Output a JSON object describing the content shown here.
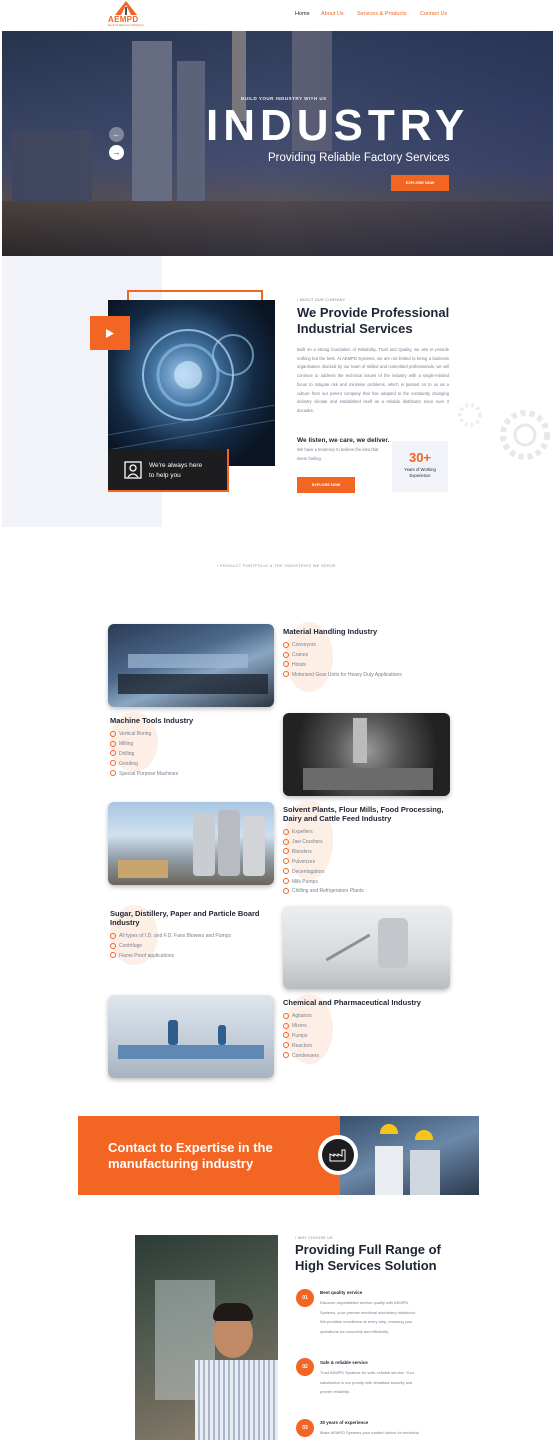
{
  "brand": {
    "logo_text": "AEMPD",
    "logo_sub": "Electrical Machinery Distributors",
    "accent": "#f26522"
  },
  "nav": {
    "items": [
      "Home",
      "About Us",
      "Services & Products",
      "Contact Us"
    ],
    "active": "Home"
  },
  "hero": {
    "eyebrow": "BUILD YOUR INDUSTRY WITH US",
    "title": "INDUSTRY",
    "subtitle": "Providing Reliable Factory Services",
    "button": "EXPLORE NOW",
    "prev_icon": "arrow-left-icon",
    "next_icon": "arrow-right-icon"
  },
  "about": {
    "eyebrow": "/ ABOUT OUR COMPANY",
    "title_line1": "We Provide Professional",
    "title_line2": "Industrial Services",
    "paragraph": "Built on a strong foundation of Reliability, Trust and Quality, we aim to provide nothing but the best. At AEMPD Systems, we are not limited to being a business organisation. Backed by our team of skilled and committed professionals, we will continue to address the technical issues of the industry with a single-minded focus to mitigate risk and minimise problems, which is passed on to us as a culture from our parent company that has adapted to the constantly changing industry climate and established itself as a reliable distributor since over 3 decades.",
    "subheading": "We listen, we care, we deliver.",
    "sub_paragraph": "We have a tendency to believe the idea that seem fooling.",
    "button": "EXPLORE NOW",
    "help_text_line1": "We're always here",
    "help_text_line2": "to help you",
    "stat_value": "30+",
    "stat_label_line1": "Years of Working",
    "stat_label_line2": "Experience"
  },
  "portfolio": {
    "eyebrow": "/ PRODUCT PORTFOLIO & THE INDUSTRIES WE SERVE",
    "industries": [
      {
        "title": "Material Handling Industry",
        "items": [
          "Conveyors",
          "Cranes",
          "Hoists",
          "Motorized Gear Units for Heavy Duty Applications"
        ]
      },
      {
        "title": "Machine Tools Industry",
        "items": [
          "Vertical Boring",
          "Milling",
          "Drilling",
          "Grinding",
          "Special Purpose Machines"
        ]
      },
      {
        "title_line1": "Solvent Plants, Flour Mills, Food Processing,",
        "title_line2": "Dairy and Cattle Feed Industry",
        "items": [
          "Expellers",
          "Jaw Crushers",
          "Blenders",
          "Pulverizes",
          "Decentagators",
          "Milk Pumps",
          "Chilling and Refrigerators Plants"
        ]
      },
      {
        "title_line1": "Sugar, Distillery, Paper and Particle Board",
        "title_line2": "Industry",
        "items": [
          "All types of I.D. and F.D. Fans Blowers and Pumps",
          "Centrifuge",
          "Flame Proof applications"
        ]
      },
      {
        "title": "Chemical and Pharmaceutical Industry",
        "items": [
          "Agitators",
          "Mixers",
          "Pumps",
          "Reactors",
          "Condensers"
        ]
      }
    ]
  },
  "cta": {
    "line1": "Contact to Expertise in the",
    "line2": "manufacturing industry"
  },
  "why": {
    "eyebrow": "/ WHY CHOOSE US",
    "title_line1": "Providing Full Range of",
    "title_line2": "High Services Solution",
    "points": [
      {
        "num": "01",
        "title": "Best quality service",
        "desc": [
          "Discover unparalleled service quality with AEMPD",
          "Systems, your premier electrical machinery distributor.",
          "We prioritise excellence at every step, ensuring your",
          "operations run smoothly and efficiently."
        ]
      },
      {
        "num": "02",
        "title": "Safe & reliable service",
        "desc": [
          "Trust AEMPD Systems for safe, reliable service. Your",
          "satisfaction is our priority with steadfast security and",
          "proven reliability."
        ]
      },
      {
        "num": "03",
        "title": "30 years of experience",
        "desc": [
          "Make AEMPD Systems your trusted choice for electrical"
        ]
      }
    ]
  }
}
